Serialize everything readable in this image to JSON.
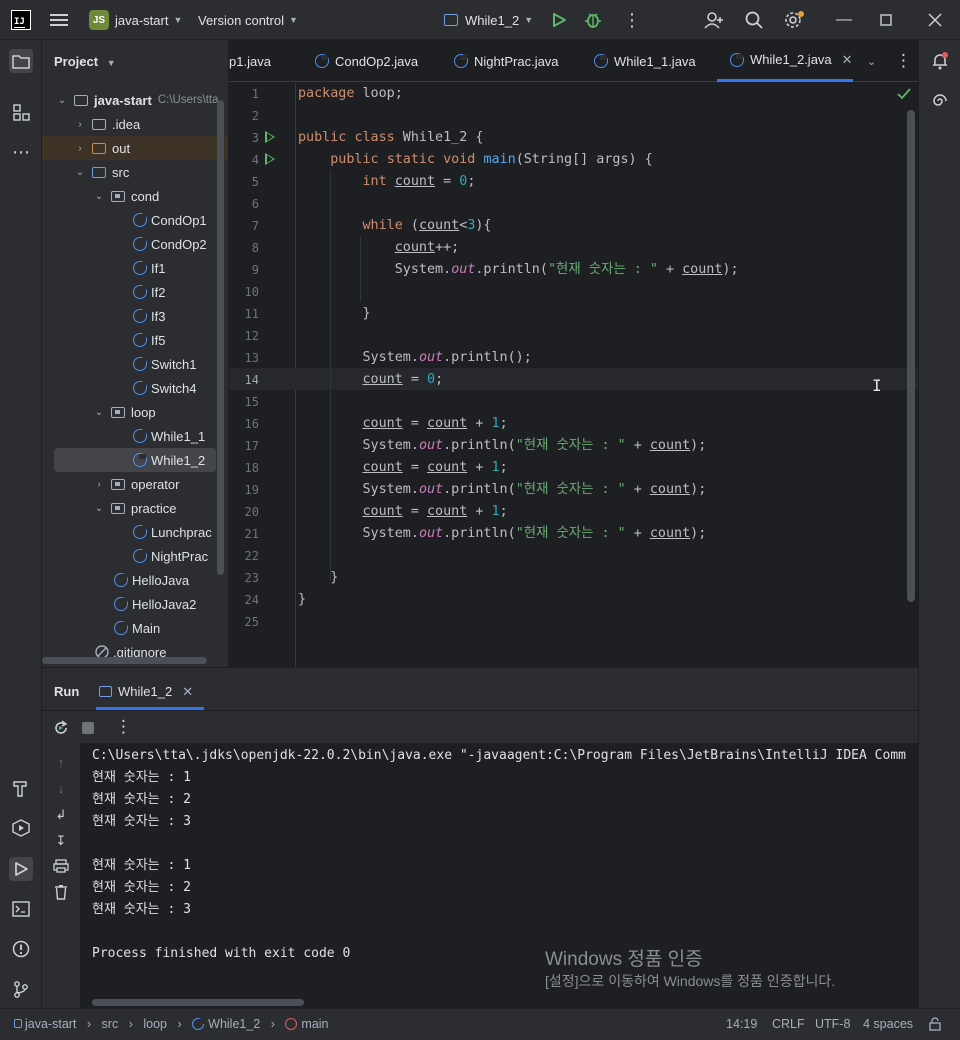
{
  "titlebar": {
    "project_badge": "JS",
    "project_name": "java-start",
    "vcs": "Version control",
    "run_config": "While1_2"
  },
  "project_panel": {
    "title": "Project",
    "root_name": "java-start",
    "root_path": "C:\\Users\\tta",
    "items": [
      {
        "label": ".idea"
      },
      {
        "label": "out"
      },
      {
        "label": "src"
      },
      {
        "label": "cond"
      },
      {
        "label": "CondOp1"
      },
      {
        "label": "CondOp2"
      },
      {
        "label": "If1"
      },
      {
        "label": "If2"
      },
      {
        "label": "If3"
      },
      {
        "label": "If5"
      },
      {
        "label": "Switch1"
      },
      {
        "label": "Switch4"
      },
      {
        "label": "loop"
      },
      {
        "label": "While1_1"
      },
      {
        "label": "While1_2"
      },
      {
        "label": "operator"
      },
      {
        "label": "practice"
      },
      {
        "label": "Lunchprac"
      },
      {
        "label": "NightPrac"
      },
      {
        "label": "HelloJava"
      },
      {
        "label": "HelloJava2"
      },
      {
        "label": "Main"
      },
      {
        "label": ".gitignore"
      }
    ]
  },
  "tabs": [
    {
      "label": "p1.java"
    },
    {
      "label": "CondOp2.java"
    },
    {
      "label": "NightPrac.java"
    },
    {
      "label": "While1_1.java"
    },
    {
      "label": "While1_2.java",
      "active": true
    }
  ],
  "editor": {
    "line_numbers": [
      "1",
      "2",
      "3",
      "4",
      "5",
      "6",
      "7",
      "8",
      "9",
      "10",
      "11",
      "12",
      "13",
      "14",
      "15",
      "16",
      "17",
      "18",
      "19",
      "20",
      "21",
      "22",
      "23",
      "24",
      "25"
    ],
    "lines": [
      "package loop;",
      "",
      "public class While1_2 {",
      "    public static void main(String[] args) {",
      "        int count = 0;",
      "",
      "        while (count<3){",
      "            count++;",
      "            System.out.println(\"현재 숫자는 : \" + count);",
      "",
      "        }",
      "",
      "        System.out.println();",
      "        count = 0;",
      "",
      "        count = count + 1;",
      "        System.out.println(\"현재 숫자는 : \" + count);",
      "        count = count + 1;",
      "        System.out.println(\"현재 숫자는 : \" + count);",
      "        count = count + 1;",
      "        System.out.println(\"현재 숫자는 : \" + count);",
      "",
      "    }",
      "}",
      ""
    ]
  },
  "run_panel": {
    "title": "Run",
    "tab_label": "While1_2",
    "console_lines": [
      "C:\\Users\\tta\\.jdks\\openjdk-22.0.2\\bin\\java.exe \"-javaagent:C:\\Program Files\\JetBrains\\IntelliJ IDEA Comm",
      "현재 숫자는 : 1",
      "현재 숫자는 : 2",
      "현재 숫자는 : 3",
      "",
      "현재 숫자는 : 1",
      "현재 숫자는 : 2",
      "현재 숫자는 : 3",
      "",
      "Process finished with exit code 0"
    ]
  },
  "watermark": {
    "title": "Windows 정품 인증",
    "subtitle": "[설정]으로 이동하여 Windows를 정품 인증합니다."
  },
  "statusbar": {
    "breadcrumb": [
      "java-start",
      "src",
      "loop",
      "While1_2",
      "main"
    ],
    "position": "14:19",
    "line_sep": "CRLF",
    "encoding": "UTF-8",
    "indent": "4 spaces"
  },
  "colors": {
    "accent": "#3574f0",
    "keyword": "#cf8e6d",
    "string": "#6aab73",
    "number": "#2aacb8",
    "field": "#c77dbb",
    "method": "#56a8f5",
    "run_green": "#5fb865"
  }
}
